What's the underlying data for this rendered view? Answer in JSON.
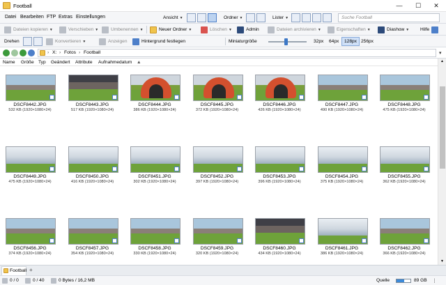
{
  "window": {
    "title": "Football",
    "minimize": "—",
    "maximize": "☐",
    "close": "✕"
  },
  "menu": [
    "Datei",
    "Bearbeiten",
    "FTP",
    "Extras",
    "Einstellungen"
  ],
  "view_bar": {
    "ansicht": "Ansicht",
    "ordner": "Ordner",
    "lister": "Lister",
    "search_placeholder": "Suche Football"
  },
  "toolbar1": {
    "copy": "Dateien kopieren",
    "move": "Verschieben",
    "rename": "Umbenennen",
    "new_folder": "Neuer Ordner",
    "delete": "Löschen",
    "admin": "Admin",
    "archive": "Dateien archivieren",
    "properties": "Eigenschaften",
    "slideshow": "Diashow",
    "help": "Hilfe"
  },
  "toolbar2": {
    "rotate": "Drehen",
    "convert": "Konvertieren",
    "show": "Anzeigen",
    "wallpaper": "Hintergrund festlegen",
    "thumb_size_label": "Miniaturgröße",
    "slider_fraction": 0.45,
    "sizes": [
      "32px",
      "64px",
      "128px",
      "256px"
    ],
    "selected_size": "128px"
  },
  "address": {
    "crumbs": [
      "X:",
      "Fotos",
      "Football"
    ]
  },
  "columns": [
    "Name",
    "Größe",
    "Typ",
    "Geändert",
    "Attribute",
    "Aufnahmedatum"
  ],
  "files": [
    {
      "name": "DSCF8442.JPG",
      "size": "532 KB (1920×1080×24)",
      "kind": "field"
    },
    {
      "name": "DSCF8443.JPG",
      "size": "517 KB (1920×1080×24)",
      "kind": "stadium"
    },
    {
      "name": "DSCF8444.JPG",
      "size": "386 KB (1920×1080×24)",
      "kind": "tunnel"
    },
    {
      "name": "DSCF8445.JPG",
      "size": "372 KB (1920×1080×24)",
      "kind": "tunnel"
    },
    {
      "name": "DSCF8446.JPG",
      "size": "426 KB (1920×1080×24)",
      "kind": "tunnel"
    },
    {
      "name": "DSCF8447.JPG",
      "size": "490 KB (1920×1080×24)",
      "kind": "field"
    },
    {
      "name": "DSCF8448.JPG",
      "size": "475 KB (1920×1080×24)",
      "kind": "field"
    },
    {
      "name": "DSCF8449.JPG",
      "size": "475 KB (1920×1080×24)",
      "kind": "smoke"
    },
    {
      "name": "DSCF8450.JPG",
      "size": "416 KB (1920×1080×24)",
      "kind": "smoke"
    },
    {
      "name": "DSCF8451.JPG",
      "size": "302 KB (1920×1080×24)",
      "kind": "smoke"
    },
    {
      "name": "DSCF8452.JPG",
      "size": "397 KB (1920×1080×24)",
      "kind": "smoke"
    },
    {
      "name": "DSCF8453.JPG",
      "size": "396 KB (1920×1080×24)",
      "kind": "smoke"
    },
    {
      "name": "DSCF8454.JPG",
      "size": "375 KB (1920×1080×24)",
      "kind": "smoke"
    },
    {
      "name": "DSCF8455.JPG",
      "size": "362 KB (1920×1080×24)",
      "kind": "smoke"
    },
    {
      "name": "DSCF8456.JPG",
      "size": "374 KB (1920×1080×24)",
      "kind": "field"
    },
    {
      "name": "DSCF8457.JPG",
      "size": "354 KB (1920×1080×24)",
      "kind": "field"
    },
    {
      "name": "DSCF8458.JPG",
      "size": "330 KB (1920×1080×24)",
      "kind": "field"
    },
    {
      "name": "DSCF8459.JPG",
      "size": "320 KB (1920×1080×24)",
      "kind": "field"
    },
    {
      "name": "DSCF8460.JPG",
      "size": "434 KB (1920×1080×24)",
      "kind": "stadium"
    },
    {
      "name": "DSCF8461.JPG",
      "size": "386 KB (1920×1080×24)",
      "kind": "smoke"
    },
    {
      "name": "DSCF8462.JPG",
      "size": "366 KB (1920×1080×24)",
      "kind": "field"
    }
  ],
  "tabs": [
    {
      "label": "Football"
    }
  ],
  "tab_add": "+",
  "status": {
    "selected": "0 / 0",
    "count": "0 / 40",
    "bytes": "0 Bytes / 16,2 MB",
    "source": "Quelle",
    "disk_free": "89 GB",
    "disk_used_fraction": 0.55
  },
  "colors": {
    "accent": "#4d7fc9",
    "folder": "#f0c44c"
  }
}
